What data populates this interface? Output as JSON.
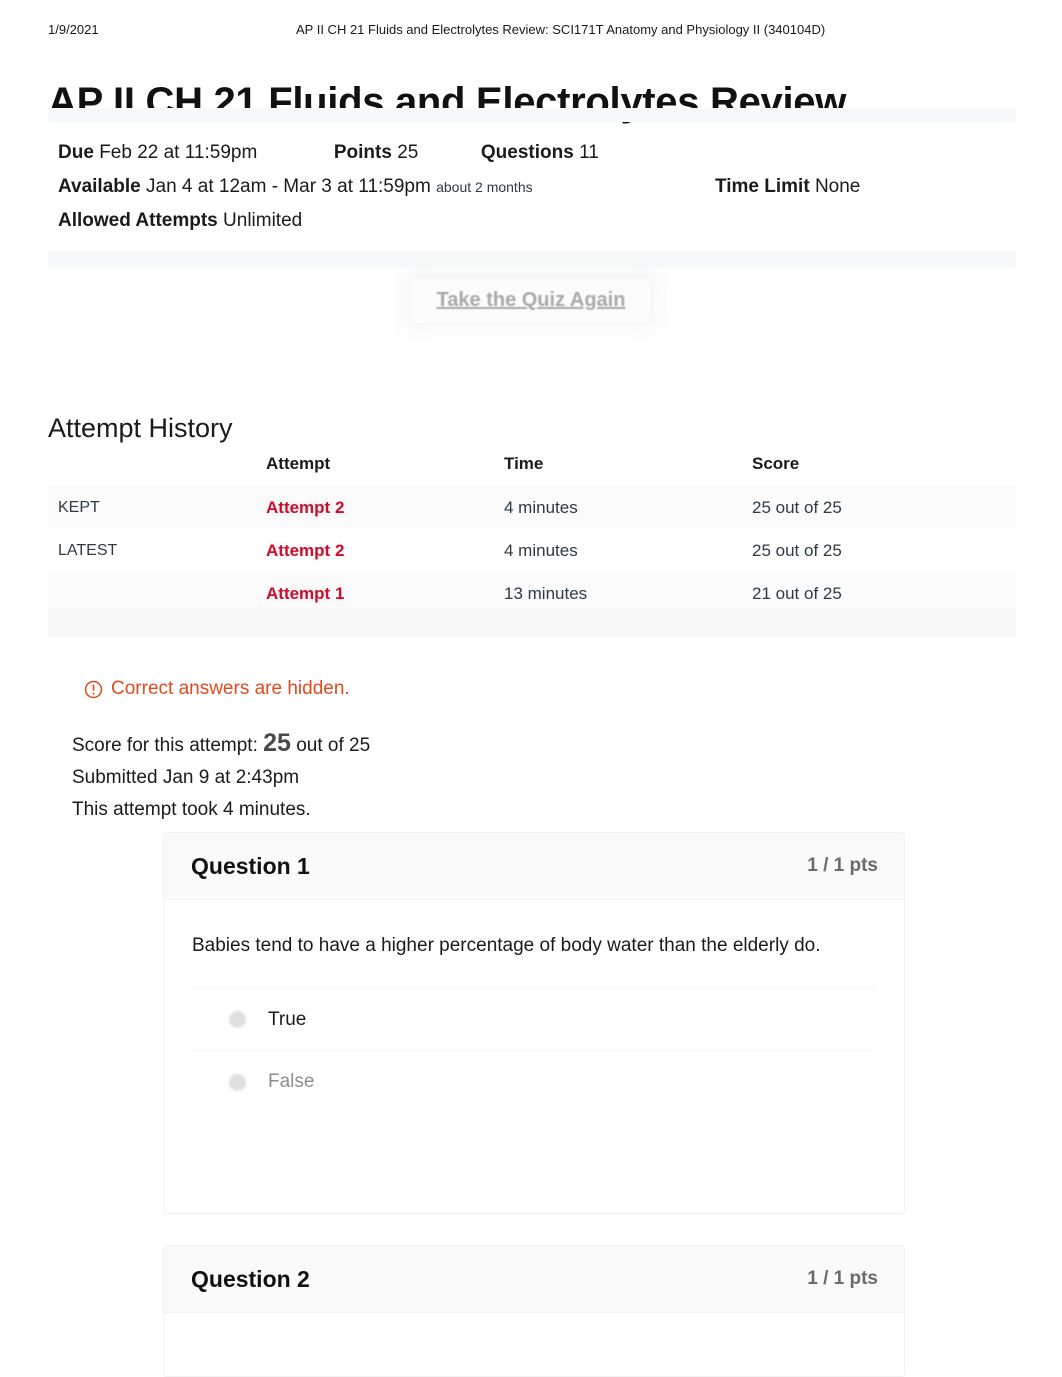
{
  "print_header": {
    "date": "1/9/2021",
    "title": "AP II CH 21 Fluids and Electrolytes Review: SCI171T Anatomy and Physiology II (340104D)"
  },
  "page_title": "AP II CH 21 Fluids and Electrolytes Review",
  "quiz_meta": {
    "due_label": "Due",
    "due_value": "Feb 22 at 11:59pm",
    "points_label": "Points",
    "points_value": "25",
    "questions_label": "Questions",
    "questions_value": "11",
    "available_label": "Available",
    "available_value": "Jan 4 at 12am - Mar 3 at 11:59pm",
    "available_duration": "about 2 months",
    "time_limit_label": "Time Limit",
    "time_limit_value": "None",
    "allowed_attempts_label": "Allowed Attempts",
    "allowed_attempts_value": "Unlimited"
  },
  "take_quiz_again_button": "Take the Quiz Again",
  "attempt_history": {
    "heading": "Attempt History",
    "columns": [
      "",
      "Attempt",
      "Time",
      "Score"
    ],
    "rows": [
      {
        "label": "KEPT",
        "attempt": "Attempt 2",
        "time": "4 minutes",
        "score": "25 out of 25"
      },
      {
        "label": "LATEST",
        "attempt": "Attempt 2",
        "time": "4 minutes",
        "score": "25 out of 25"
      },
      {
        "label": "",
        "attempt": "Attempt 1",
        "time": "13 minutes",
        "score": "21 out of 25"
      }
    ]
  },
  "hidden_notice": {
    "icon": "warning-circle-icon",
    "text": "Correct answers are hidden."
  },
  "score_summary": {
    "score_prefix": "Score for this attempt:",
    "score_value": "25",
    "score_suffix": "out of 25",
    "submitted": "Submitted Jan 9 at 2:43pm",
    "duration": "This attempt took 4 minutes."
  },
  "questions": [
    {
      "name": "Question 1",
      "points": "1 / 1 pts",
      "text": "Babies tend to have a higher percentage of body water than the elderly do.",
      "answers": [
        {
          "label": "True",
          "selected": true
        },
        {
          "label": "False",
          "selected": false
        }
      ]
    },
    {
      "name": "Question 2",
      "points": "1 / 1 pts",
      "text": "",
      "answers": []
    }
  ],
  "colors": {
    "attempt_link": "#C8102E",
    "warning": "#DF4B1F",
    "text": "#1b1b1b",
    "muted": "#8e8e8e",
    "band": "#f7f8f9"
  }
}
